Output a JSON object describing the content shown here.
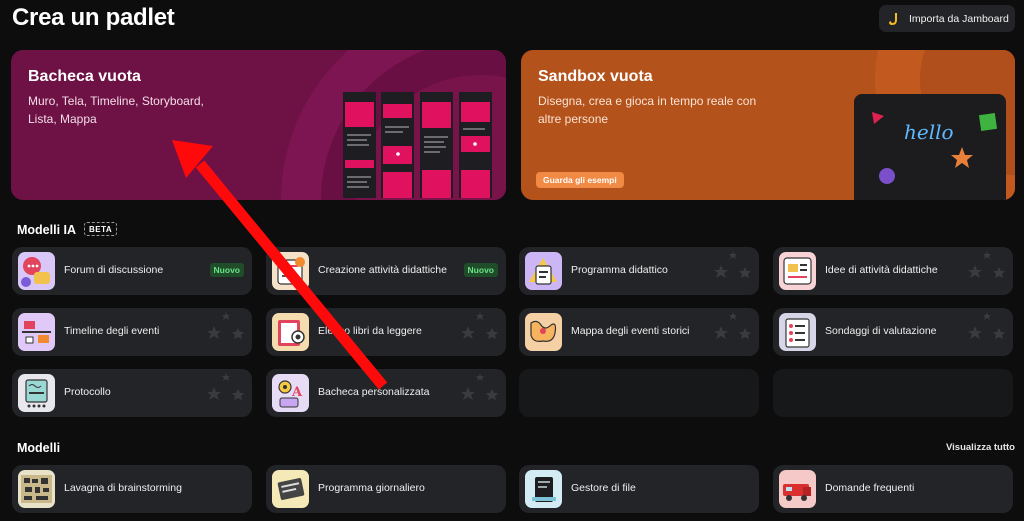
{
  "page_title": "Crea un padlet",
  "import_button": {
    "label": "Importa da Jamboard",
    "icon": "jamboard-icon"
  },
  "hero_blank": {
    "title": "Bacheca vuota",
    "description": "Muro, Tela, Timeline, Storyboard, Lista, Mappa"
  },
  "hero_sandbox": {
    "title": "Sandbox vuota",
    "description": "Disegna, crea e gioca in tempo reale con altre persone",
    "button": "Guarda gli esempi",
    "sketch_text": "hello"
  },
  "ai_section": {
    "title": "Modelli IA",
    "badge": "BETA",
    "cards": [
      {
        "label": "Forum di discussione",
        "badge": "Nuovo",
        "icon": "discussion-icon"
      },
      {
        "label": "Creazione attività didattiche",
        "badge": "Nuovo",
        "icon": "activity-creation-icon"
      },
      {
        "label": "Programma didattico",
        "icon": "syllabus-icon"
      },
      {
        "label": "Idee di attività didattiche",
        "icon": "activity-ideas-icon"
      },
      {
        "label": "Timeline degli eventi",
        "icon": "timeline-icon"
      },
      {
        "label": "Elenco libri da leggere",
        "icon": "reading-list-icon"
      },
      {
        "label": "Mappa degli eventi storici",
        "icon": "historical-map-icon"
      },
      {
        "label": "Sondaggi di valutazione",
        "icon": "survey-icon"
      },
      {
        "label": "Protocollo",
        "icon": "protocol-icon"
      },
      {
        "label": "Bacheca personalizzata",
        "icon": "custom-board-icon"
      }
    ]
  },
  "templates_section": {
    "title": "Modelli",
    "view_all": "Visualizza tutto",
    "cards": [
      {
        "label": "Lavagna di brainstorming",
        "icon": "brainstorm-icon"
      },
      {
        "label": "Programma giornaliero",
        "icon": "daily-schedule-icon"
      },
      {
        "label": "Gestore di file",
        "icon": "file-manager-icon"
      },
      {
        "label": "Domande frequenti",
        "icon": "faq-icon"
      }
    ]
  },
  "colors": {
    "background": "#0d0d0e",
    "card": "#232427",
    "hero_blank": "#6e1145",
    "hero_sandbox": "#b4521c",
    "accent_pink": "#e0115f",
    "badge_green": "#6be184",
    "arrow": "#ff0a0a"
  }
}
